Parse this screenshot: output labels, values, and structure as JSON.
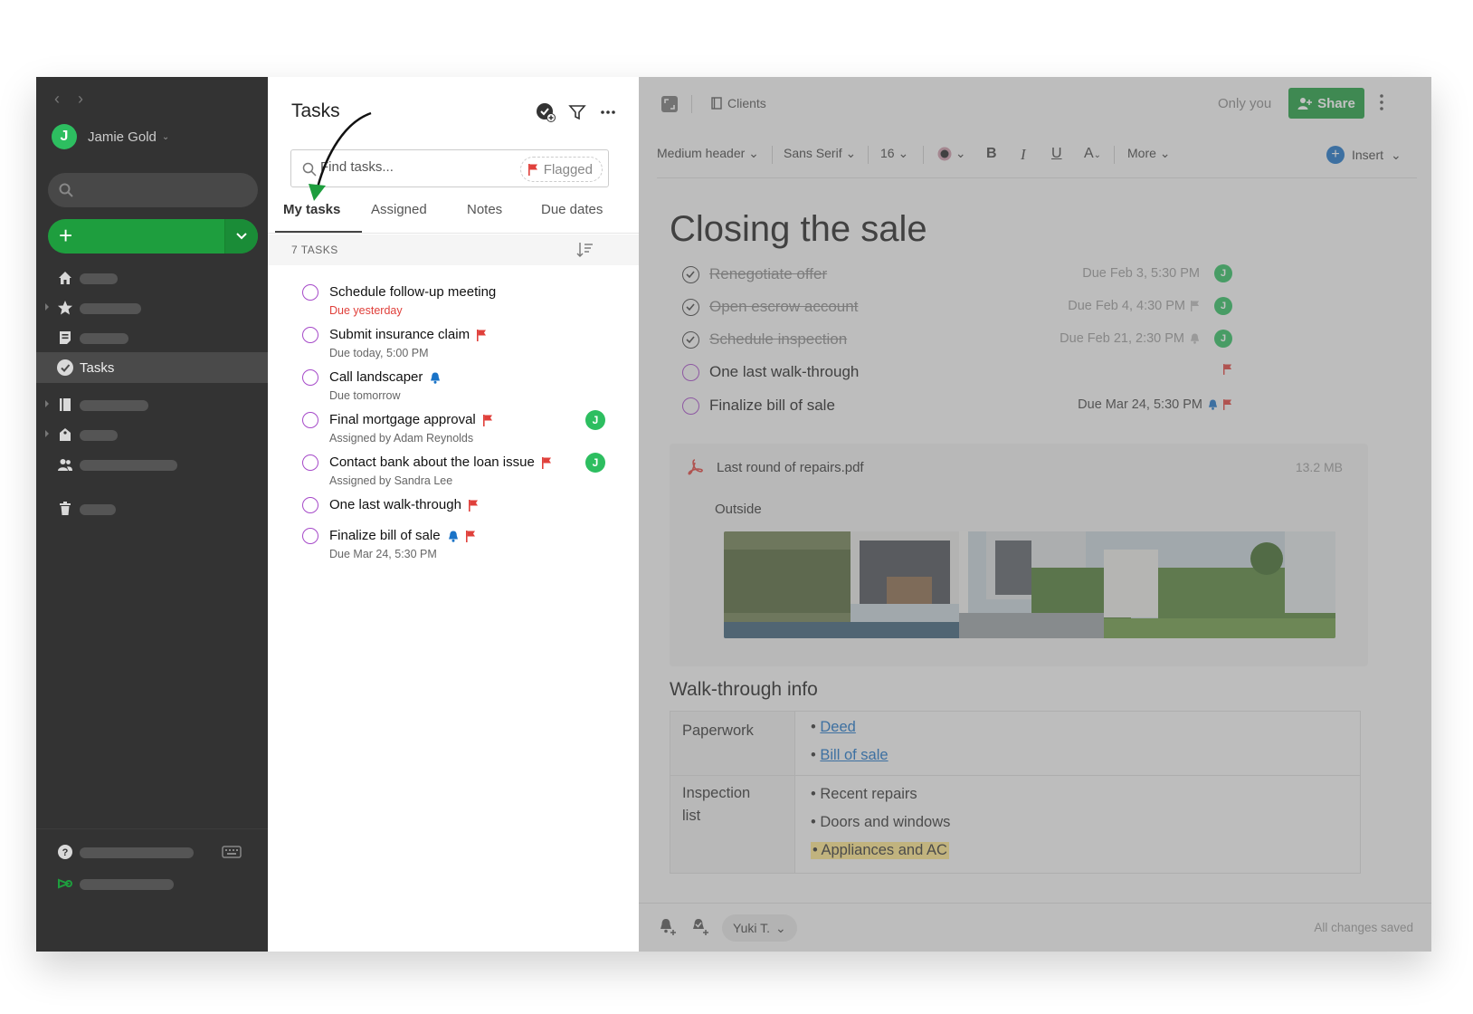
{
  "sidebar": {
    "user_name": "Jamie Gold",
    "user_initial": "J",
    "active_item": "Tasks"
  },
  "tasks_panel": {
    "title": "Tasks",
    "search_placeholder": "Find tasks...",
    "flagged_chip": "Flagged",
    "tabs": [
      "My tasks",
      "Assigned",
      "Notes",
      "Due dates"
    ],
    "count_label": "7 TASKS",
    "items": [
      {
        "title": "Schedule follow-up meeting",
        "sub": "Due yesterday"
      },
      {
        "title": "Submit insurance claim",
        "sub": "Due today, 5:00 PM"
      },
      {
        "title": "Call landscaper",
        "sub": "Due tomorrow"
      },
      {
        "title": "Final mortgage approval",
        "sub": "Assigned by Adam Reynolds"
      },
      {
        "title": "Contact bank about the loan issue",
        "sub": "Assigned by Sandra Lee"
      },
      {
        "title": "One last walk-through",
        "sub": ""
      },
      {
        "title": "Finalize bill of sale",
        "sub": "Due Mar 24, 5:30 PM"
      }
    ]
  },
  "note": {
    "notebook": "Clients",
    "only_you": "Only you",
    "share_label": "Share",
    "toolbar": {
      "style": "Medium header",
      "font": "Sans Serif",
      "size": "16",
      "more": "More",
      "insert": "Insert"
    },
    "title": "Closing the sale",
    "tasks": [
      {
        "title": "Renegotiate offer",
        "due": "Due Feb 3, 5:30 PM"
      },
      {
        "title": "Open escrow account",
        "due": "Due Feb 4, 4:30 PM"
      },
      {
        "title": "Schedule inspection",
        "due": "Due Feb 21, 2:30 PM"
      },
      {
        "title": "One last walk-through",
        "due": ""
      },
      {
        "title": "Finalize bill of sale",
        "due": "Due Mar 24, 5:30 PM"
      }
    ],
    "attachment": {
      "name": "Last round of repairs.pdf",
      "size": "13.2 MB",
      "caption": "Outside"
    },
    "section_heading": "Walk-through info",
    "table": {
      "row1_header": "Paperwork",
      "row1_items": [
        "Deed",
        "Bill of sale"
      ],
      "row2_header_line1": "Inspection",
      "row2_header_line2": "list",
      "row2_items": [
        "Recent repairs",
        "Doors and windows",
        "Appliances and AC"
      ]
    },
    "collaborator": "Yuki T.",
    "status": "All changes saved"
  },
  "colors": {
    "sidebar_bg": "#333333",
    "accent_green": "#1e9e3e",
    "task_circle": "#a64ac9",
    "flag_red": "#e0403b",
    "bell_blue": "#1a73c7"
  }
}
